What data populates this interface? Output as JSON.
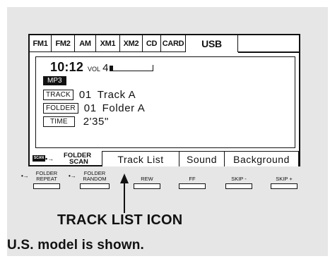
{
  "tabs": [
    {
      "label": "FM1",
      "active": false
    },
    {
      "label": "FM2",
      "active": false
    },
    {
      "label": "AM",
      "active": false
    },
    {
      "label": "XM1",
      "active": false
    },
    {
      "label": "XM2",
      "active": false
    },
    {
      "label": "CD",
      "active": false
    },
    {
      "label": "CARD",
      "active": false
    },
    {
      "label": "USB",
      "active": true
    }
  ],
  "status": {
    "clock": "10:12",
    "volume_label": "VOL",
    "volume_value": "4",
    "volume_level_fraction": 0.08
  },
  "format_badge": "MP3",
  "track": {
    "tag": "TRACK",
    "number": "01",
    "title": "Track A"
  },
  "folder": {
    "tag": "FOLDER",
    "number": "01",
    "title": "Folder A"
  },
  "time": {
    "tag": "TIME",
    "value": "2'35\""
  },
  "scan": {
    "icon_text": "SCAN",
    "line1": "FOLDER",
    "line2": "SCAN"
  },
  "softkeys": [
    "Track List",
    "Sound",
    "Background"
  ],
  "hardkeys": [
    {
      "line1": "FOLDER",
      "line2": "REPEAT"
    },
    {
      "line1": "FOLDER",
      "line2": "RANDOM"
    },
    {
      "line1": "",
      "line2": "REW"
    },
    {
      "line1": "",
      "line2": "FF"
    },
    {
      "line1": "",
      "line2": "SKIP -"
    },
    {
      "line1": "",
      "line2": "SKIP +"
    }
  ],
  "callout": "TRACK LIST ICON",
  "note": "U.S. model is shown."
}
